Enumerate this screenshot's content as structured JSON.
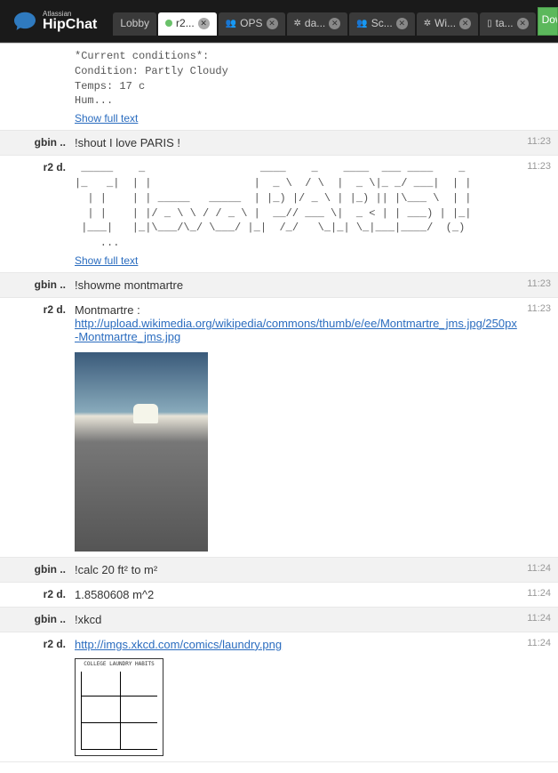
{
  "header": {
    "brand_small": "Atlassian",
    "brand_main": "HipChat",
    "download": "Downlo"
  },
  "tabs": [
    {
      "label": "Lobby",
      "closable": false,
      "active": false,
      "icon": ""
    },
    {
      "label": "r2...",
      "closable": true,
      "active": true,
      "icon": "status"
    },
    {
      "label": "OPS",
      "closable": true,
      "active": false,
      "icon": "people"
    },
    {
      "label": "da...",
      "closable": true,
      "active": false,
      "icon": "gear"
    },
    {
      "label": "Sc...",
      "closable": true,
      "active": false,
      "icon": "people"
    },
    {
      "label": "Wi...",
      "closable": true,
      "active": false,
      "icon": "gear"
    },
    {
      "label": "ta...",
      "closable": true,
      "active": false,
      "icon": "mobile"
    }
  ],
  "messages": [
    {
      "sender": "",
      "time": "",
      "type": "pre",
      "highlight": false,
      "text": "*Current conditions*:\nCondition: Partly Cloudy\nTemps: 17 c\nHum...",
      "show_full": "Show full text"
    },
    {
      "sender": "gbin ..",
      "time": "11:23",
      "type": "text",
      "highlight": true,
      "text": "!shout I love PARIS !"
    },
    {
      "sender": "r2 d.",
      "time": "11:23",
      "type": "pre",
      "highlight": false,
      "text": " _____    _                  ____    _    ____  ___ ____    _ \n|_   _|  | |                |  _ \\  / \\  |  _ \\|_ _/ ___|  | |\n  | |    | | _____   _____  | |_) |/ _ \\ | |_) || |\\___ \\  | |\n  | |    | |/ _ \\ \\ / / _ \\ |  __// ___ \\|  _ < | | ___) | |_|\n |___|   |_|\\___/\\_/ \\___/ |_|  /_/   \\_|_| \\_|___|____/  (_)\n    ...",
      "show_full": "Show full text"
    },
    {
      "sender": "gbin ..",
      "time": "11:23",
      "type": "text",
      "highlight": true,
      "text": "!showme montmartre"
    },
    {
      "sender": "r2 d.",
      "time": "11:23",
      "type": "link-image",
      "highlight": false,
      "prefix": "Montmartre : ",
      "url": "http://upload.wikimedia.org/wikipedia/commons/thumb/e/ee/Montmartre_jms.jpg/250px-Montmartre_jms.jpg"
    },
    {
      "sender": "gbin ..",
      "time": "11:24",
      "type": "text",
      "highlight": true,
      "text": "!calc 20 ft² to m²"
    },
    {
      "sender": "r2 d.",
      "time": "11:24",
      "type": "text",
      "highlight": false,
      "text": "1.8580608 m^2"
    },
    {
      "sender": "gbin ..",
      "time": "11:24",
      "type": "text",
      "highlight": true,
      "text": "!xkcd"
    },
    {
      "sender": "r2 d.",
      "time": "11:24",
      "type": "link-comic",
      "highlight": false,
      "url": "http://imgs.xkcd.com/comics/laundry.png"
    }
  ]
}
